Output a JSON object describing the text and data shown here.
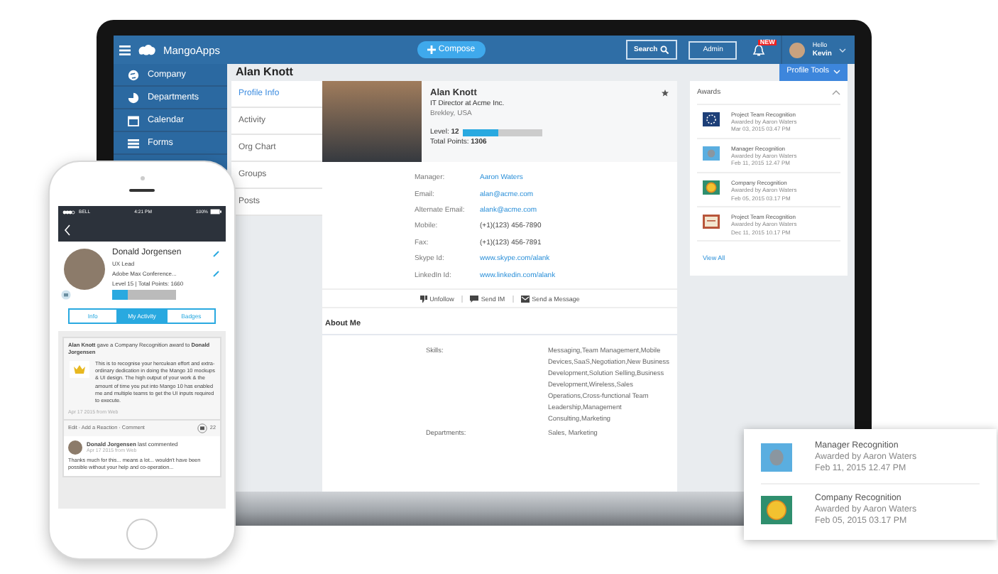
{
  "laptop": {
    "topbar": {
      "app_name": "MangoApps",
      "compose_button": "Compose",
      "search_button": "Search",
      "admin_button": "Admin",
      "notification_badge": "NEW",
      "greeting": "Hello",
      "user_name": "Kevin"
    },
    "sidebar": {
      "items": [
        {
          "label": "Company",
          "selected": false
        },
        {
          "label": "Departments",
          "selected": false
        },
        {
          "label": "Calendar",
          "selected": false
        },
        {
          "label": "Forms",
          "selected": false
        }
      ]
    },
    "page_title": "Alan Knott",
    "profile_tools_button": "Profile Tools",
    "tabs": [
      {
        "label": "Profile Info",
        "selected": true
      },
      {
        "label": "Activity",
        "selected": false
      },
      {
        "label": "Org Chart",
        "selected": false
      },
      {
        "label": "Groups",
        "selected": false
      },
      {
        "label": "Posts",
        "selected": false
      }
    ],
    "profile": {
      "name": "Alan Knott",
      "title": "IT Director at Acme Inc.",
      "location": "Brekley, USA",
      "level_label": "Level:",
      "level_value": "12",
      "level": 0.45,
      "points_label": "Total Points:",
      "points_value": "1306",
      "fields": [
        {
          "label": "Manager:",
          "value": "Aaron Waters",
          "kind": "link"
        },
        {
          "label": "Email:",
          "value": "alan@acme.com",
          "kind": "link"
        },
        {
          "label": "Alternate Email:",
          "value": "alank@acme.com",
          "kind": "link"
        },
        {
          "label": "Mobile:",
          "value": "(+1)(123) 456-7890",
          "kind": "text"
        },
        {
          "label": "Fax:",
          "value": "(+1)(123) 456-7891",
          "kind": "text"
        },
        {
          "label": "Skype Id:",
          "value": "www.skype.com/alank",
          "kind": "link"
        },
        {
          "label": "LinkedIn Id:",
          "value": "www.linkedin.com/alank",
          "kind": "link"
        }
      ],
      "actions": [
        "Unfollow",
        "Send IM",
        "Send a Message"
      ],
      "about_title": "About Me",
      "about": [
        {
          "label": "Skills:",
          "value": "Messaging,Team Management,Mobile Devices,SaaS,Negotiation,New Business Development,Solution Selling,Business Development,Wireless,Sales Operations,Cross-functional Team Leadership,Management Consulting,Marketing"
        },
        {
          "label": "Departments:",
          "value": "Sales, Marketing"
        }
      ]
    },
    "awards": {
      "title": "Awards",
      "items": [
        {
          "kind": "team",
          "title": "Project Team Recognition",
          "by": "Awarded by Aaron Waters",
          "date": "Mar 03, 2015 03.47 PM"
        },
        {
          "kind": "manager",
          "title": "Manager Recognition",
          "by": "Awarded by Aaron Waters",
          "date": "Feb 11, 2015 12.47 PM"
        },
        {
          "kind": "company",
          "title": "Company Recognition",
          "by": "Awarded by Aaron Waters",
          "date": "Feb 05, 2015 03.17 PM"
        },
        {
          "kind": "certificate",
          "title": "Project Team Recognition",
          "by": "Awarded by Aaron Waters",
          "date": "Dec 11, 2015 10.17 PM"
        }
      ],
      "view_all": "View All"
    }
  },
  "phone": {
    "status_bar": {
      "carrier": "BELL",
      "time": "4:21 PM",
      "battery": "100%"
    },
    "profile": {
      "name": "Donald Jorgensen",
      "role": "UX Lead",
      "event": "Adobe Max Conference...",
      "stats": "Level 15 | Total Points: 1660",
      "level": 0.25
    },
    "tabs": [
      {
        "label": "Info",
        "selected": false
      },
      {
        "label": "My Activity",
        "selected": true
      },
      {
        "label": "Badges",
        "selected": false
      }
    ],
    "post": {
      "intro": "**Alan Knott** gave a Company Recognition award to **Donald Jorgensen**",
      "body": "This is to recognise your herculean effort and extra-ordinary dedication in doing the Mango 10 mockups & UI design. The high output of your work & the amount of time you put into Mango 10 has enabled me and multiple teams to get the UI inputs required to execute.",
      "meta": "Apr 17 2015 from Web",
      "actions": "Edit · Add a Reaction · Comment",
      "comment_count": "22"
    },
    "comment": {
      "author": "Donald Jorgensen",
      "action": "last commented",
      "meta": "Apr 17 2015 from Web",
      "text": "Thanks much for this... means a lot... wouldn't have been possible without your help and co-operation..."
    }
  },
  "award_card": {
    "items": [
      {
        "kind": "manager",
        "title": "Manager Recognition",
        "by": "Awarded by Aaron Waters",
        "date": "Feb 11, 2015 12.47 PM"
      },
      {
        "kind": "company",
        "title": "Company Recognition",
        "by": "Awarded by Aaron Waters",
        "date": "Feb 05, 2015 03.17 PM"
      }
    ]
  }
}
